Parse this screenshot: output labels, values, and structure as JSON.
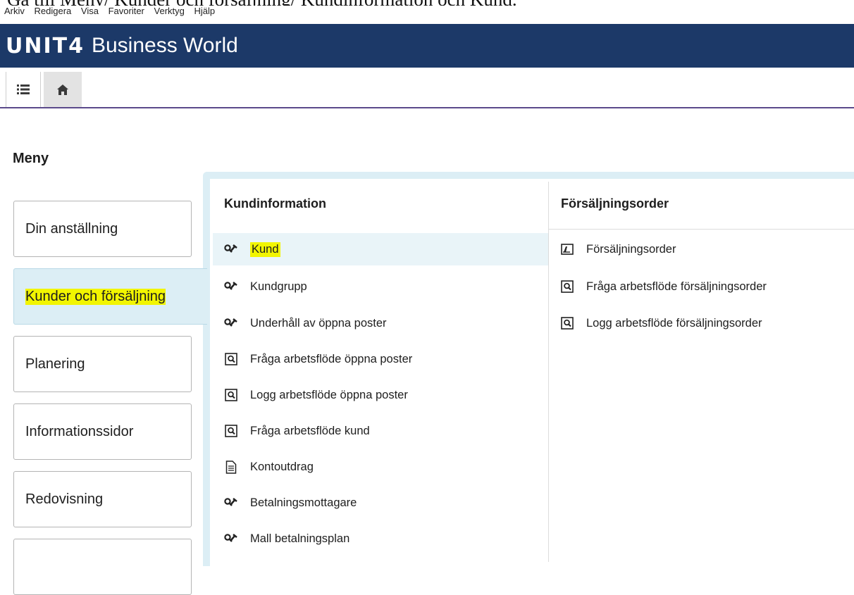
{
  "caption": {
    "text": "Gå till Meny/ Kunder och försäljning/ Kundinformation och Kund."
  },
  "menubar": {
    "items": [
      "Arkiv",
      "Redigera",
      "Visa",
      "Favoriter",
      "Verktyg",
      "Hjälp"
    ]
  },
  "app": {
    "brand": "UNIT4",
    "title": "Business World",
    "brand_color": "#1c3968"
  },
  "toolbar": {
    "menu_icon": "list-icon",
    "home_icon": "home-icon"
  },
  "meny": {
    "title": "Meny"
  },
  "left_tabs": [
    {
      "label": "Din anställning",
      "active": false
    },
    {
      "label": "Kunder och försäljning",
      "active": true
    },
    {
      "label": "Planering",
      "active": false
    },
    {
      "label": "Informationssidor",
      "active": false
    },
    {
      "label": "Redovisning",
      "active": false
    },
    {
      "label": "",
      "active": false
    }
  ],
  "columns": [
    {
      "header": "Kundinformation",
      "items": [
        {
          "label": "Kund",
          "icon": "wrench-hammer-icon",
          "selected": true
        },
        {
          "label": "Kundgrupp",
          "icon": "wrench-hammer-icon"
        },
        {
          "label": "Underhåll av öppna poster",
          "icon": "wrench-hammer-icon"
        },
        {
          "label": "Fråga arbetsflöde öppna poster",
          "icon": "query-icon"
        },
        {
          "label": "Logg arbetsflöde öppna poster",
          "icon": "query-icon"
        },
        {
          "label": "Fråga arbetsflöde kund",
          "icon": "query-icon"
        },
        {
          "label": "Kontoutdrag",
          "icon": "document-icon"
        },
        {
          "label": "Betalningsmottagare",
          "icon": "wrench-hammer-icon"
        },
        {
          "label": "Mall betalningsplan",
          "icon": "wrench-hammer-icon"
        }
      ]
    },
    {
      "header": "Försäljningsorder",
      "items": [
        {
          "label": "Försäljningsorder",
          "icon": "form-icon"
        },
        {
          "label": "Fråga arbetsflöde försäljningsorder",
          "icon": "query-icon"
        },
        {
          "label": "Logg arbetsflöde försäljningsorder",
          "icon": "query-icon"
        }
      ]
    }
  ],
  "colors": {
    "highlight": "#f2f500",
    "active_tab": "#dceef5",
    "selected_row": "#e9f4f8"
  }
}
